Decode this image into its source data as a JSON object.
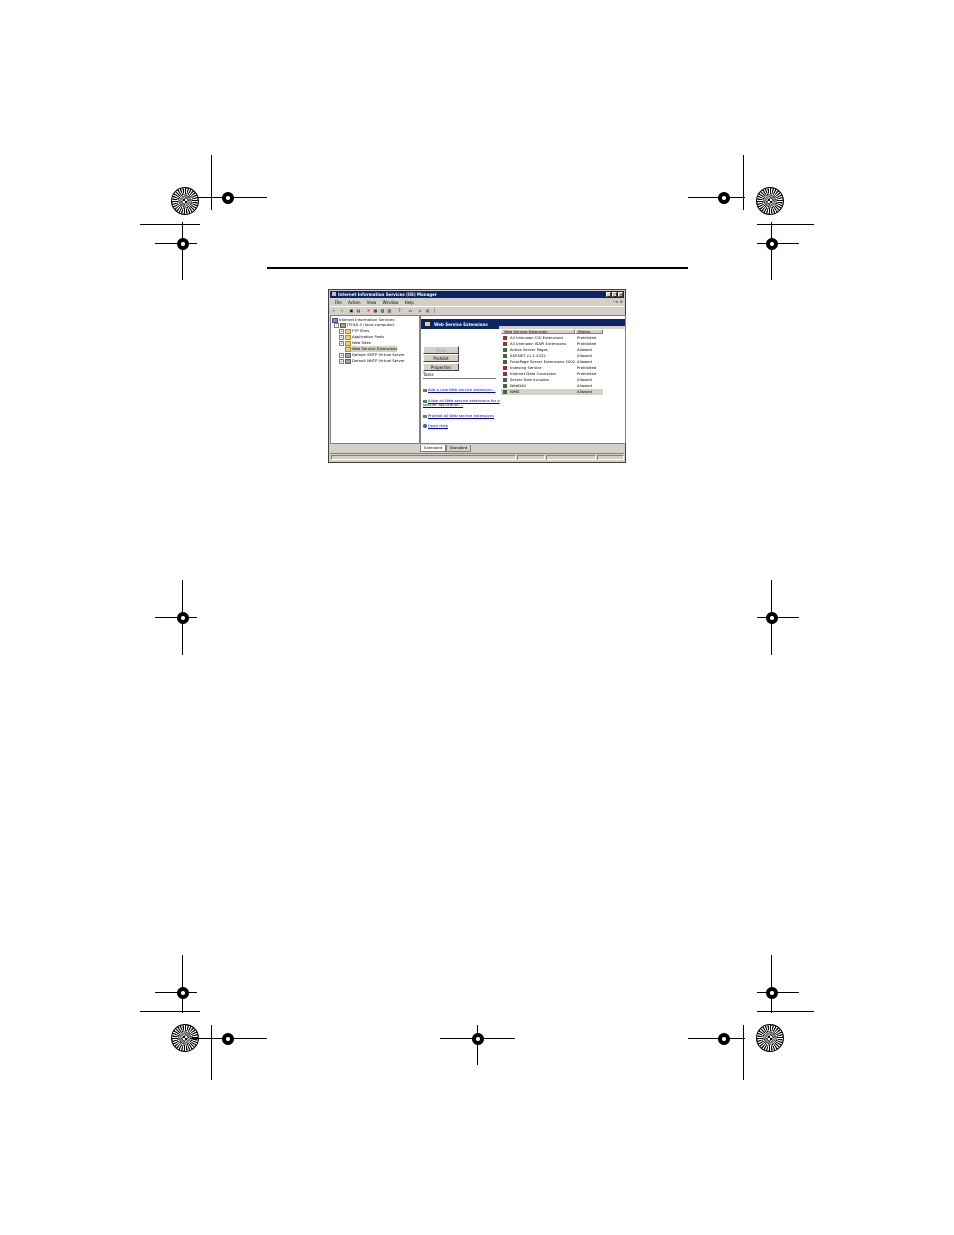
{
  "window": {
    "title": "Internet Information Services (IIS) Manager",
    "controls": [
      "_",
      "□",
      "×"
    ]
  },
  "menu": [
    {
      "label": "File"
    },
    {
      "label": "Action"
    },
    {
      "label": "View"
    },
    {
      "label": "Window"
    },
    {
      "label": "Help"
    }
  ],
  "toolbar": {
    "icons": [
      "back-icon",
      "forward-icon",
      "up-icon",
      "show-tree-icon",
      "delete-icon",
      "properties-icon",
      "refresh-icon",
      "export-icon",
      "help-icon",
      "computer-icon",
      "play-icon",
      "stop-icon",
      "pause-icon"
    ]
  },
  "tree": {
    "root": "Internet Information Services",
    "computer": "JTFILE-3 (local computer)",
    "items": [
      {
        "label": "FTP Sites"
      },
      {
        "label": "Application Pools"
      },
      {
        "label": "Web Sites"
      },
      {
        "label": "Web Service Extensions"
      },
      {
        "label": "Default SMTP Virtual Server"
      },
      {
        "label": "Default NNTP Virtual Server"
      }
    ]
  },
  "panel": {
    "title": "Web Service Extensions",
    "buttons": {
      "allow": "Allow",
      "prohibit": "Prohibit",
      "properties": "Properties"
    },
    "tasks_label": "Tasks",
    "tasks": [
      "Add a new Web service extension...",
      "Allow all Web service extensions for a",
      "specific application...",
      "Prohibit all Web service extensions",
      "Open Help"
    ]
  },
  "list": {
    "headers": {
      "name": "Web Service Extension",
      "status": "Status"
    },
    "rows": [
      {
        "name": "All Unknown CGI Extensions",
        "status": "Prohibited"
      },
      {
        "name": "All Unknown ISAPI Extensions",
        "status": "Prohibited"
      },
      {
        "name": "Active Server Pages",
        "status": "Allowed"
      },
      {
        "name": "ASP.NET v1.1.4322",
        "status": "Allowed"
      },
      {
        "name": "FrontPage Server Extensions 2002",
        "status": "Allowed"
      },
      {
        "name": "Indexing Service",
        "status": "Prohibited"
      },
      {
        "name": "Internet Data Connector",
        "status": "Prohibited"
      },
      {
        "name": "Server Side Includes",
        "status": "Allowed"
      },
      {
        "name": "WebDAV",
        "status": "Allowed"
      },
      {
        "name": "WMS",
        "status": "Allowed"
      }
    ]
  },
  "tabs": {
    "extended": "Extended",
    "standard": "Standard"
  }
}
